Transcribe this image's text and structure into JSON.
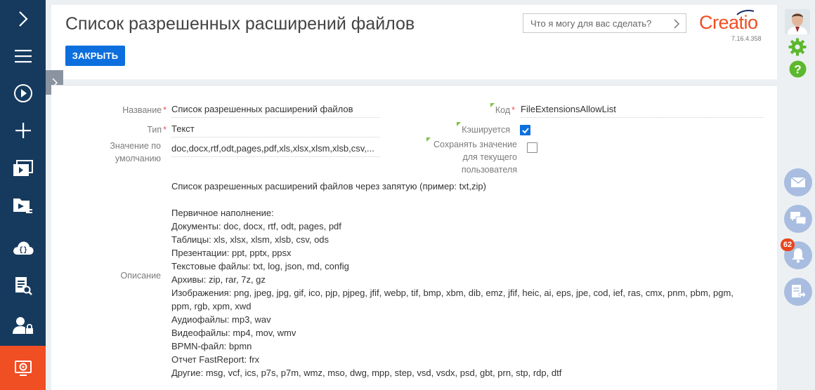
{
  "header": {
    "title": "Список разрешенных расширений файлов",
    "close_label": "ЗАКРЫТЬ",
    "search_placeholder": "Что я могу для вас сделать?",
    "logo_text": "Creatio",
    "version": "7.16.4.358"
  },
  "form": {
    "name_label": "Название",
    "name_value": "Список разрешенных расширений файлов",
    "type_label": "Тип",
    "type_value": "Текст",
    "default_label_1": "Значение по",
    "default_label_2": "умолчанию",
    "default_value": "doc,docx,rtf,odt,pages,pdf,xls,xlsx,xlsm,xlsb,csv,...",
    "code_label": "Код",
    "code_value": "FileExtensionsAllowList",
    "cached_label": "Кэшируется",
    "cached_checked": true,
    "save_label_1": "Сохранять значение",
    "save_label_2": "для текущего",
    "save_label_3": "пользователя",
    "save_checked": false,
    "description_label": "Описание",
    "description_lines": [
      "Список разрешенных расширений файлов через запятую (пример: txt,zip)",
      "",
      "Первичное наполнение:",
      "Документы: doc, docx, rtf, odt, pages, pdf",
      "Таблицы: xls, xlsx, xlsm, xlsb, csv, ods",
      "Презентации: ppt, pptx, ppsx",
      "Текстовые файлы: txt, log, json, md, config",
      "Архивы: zip, rar, 7z, gz",
      "Изображения: png, jpeg, jpg, gif, ico, pjp, pjpeg, jfif, webp, tif, bmp, xbm, dib, emz, jfif, heic, ai, eps, jpe, cod, ief, ras, cmx, pnm, pbm, pgm,",
      "ppm, rgb, xpm, xwd",
      "Аудиофайлы: mp3, wav",
      "Видеофайлы: mp4, mov, wmv",
      "BPMN-файл: bpmn",
      "Отчет FastReport: frx",
      "Другие: msg, vcf, ics, p7s, p7m, wmz, mso, dwg, mpp, step, vsd, vsdx, psd, gbt, prn, stp, rdp, dtf"
    ]
  },
  "notifications": {
    "count": "62"
  },
  "colors": {
    "nav_bg": "#163a5e",
    "accent_orange": "#f04e23",
    "primary_blue": "#0d6fde",
    "required_marker": "#7cc242"
  },
  "left_nav_icons": [
    "chevron-right-icon",
    "menu-icon",
    "play-icon",
    "plus-icon",
    "folders-icon",
    "video-folder-icon",
    "cloud-code-icon",
    "document-search-icon",
    "user-lock-icon",
    "settings-monitor-icon"
  ],
  "right_panel_icons": [
    "avatar",
    "gear-icon",
    "help-icon",
    "mail-icon",
    "chat-icon",
    "bell-icon",
    "document-arrow-icon"
  ]
}
